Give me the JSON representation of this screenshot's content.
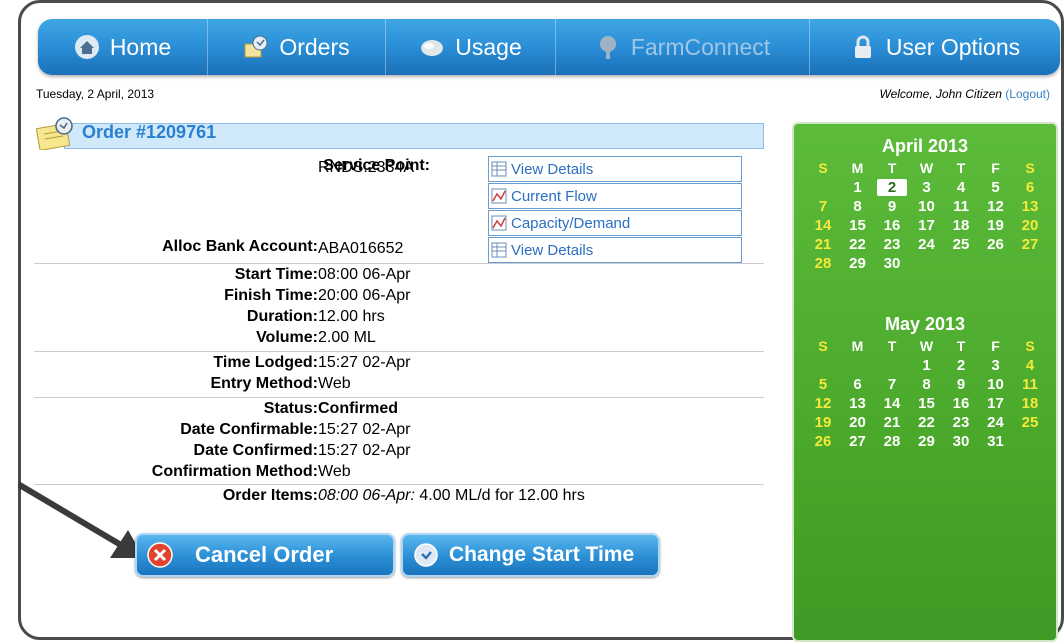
{
  "nav": {
    "items": [
      {
        "label": "Home",
        "icon": "home-icon"
      },
      {
        "label": "Orders",
        "icon": "orders-icon"
      },
      {
        "label": "Usage",
        "icon": "usage-icon"
      },
      {
        "label": "FarmConnect",
        "icon": "farmconnect-icon"
      },
      {
        "label": "User Options",
        "icon": "lock-icon"
      }
    ]
  },
  "header": {
    "date": "Tuesday, 2 April, 2013",
    "welcome": "Welcome, John Citizen",
    "logout": "(Logout)"
  },
  "order": {
    "title": "Order #1209761",
    "service_point_label": "Service Point:",
    "service_point": "RNDS.2334A",
    "links": [
      "View Details",
      "Current Flow",
      "Capacity/Demand",
      "View Details"
    ],
    "alloc_label": "Alloc Bank Account:",
    "alloc": "ABA016652",
    "start_label": "Start Time:",
    "start": "08:00 06-Apr",
    "finish_label": "Finish Time:",
    "finish": "20:00 06-Apr",
    "duration_label": "Duration:",
    "duration": "12.00 hrs",
    "volume_label": "Volume:",
    "volume": "2.00 ML",
    "lodged_label": "Time Lodged:",
    "lodged": "15:27 02-Apr",
    "entry_label": "Entry Method:",
    "entry": "Web",
    "status_label": "Status:",
    "status": "Confirmed",
    "confirmable_label": "Date Confirmable:",
    "confirmable": "15:27 02-Apr",
    "confirmed_label": "Date Confirmed:",
    "confirmed": "15:27 02-Apr",
    "conf_method_label": "Confirmation Method:",
    "conf_method": "Web",
    "items_label": "Order Items:",
    "items_time": "08:00 06-Apr:",
    "items_value": "4.00 ML/d for 12.00 hrs"
  },
  "buttons": {
    "cancel": "Cancel Order",
    "change": "Change Start Time"
  },
  "calendar": {
    "dow": [
      "S",
      "M",
      "T",
      "W",
      "T",
      "F",
      "S"
    ],
    "months": [
      {
        "title": "April 2013",
        "start": 1,
        "days": 30,
        "today": 2
      },
      {
        "title": "May 2013",
        "start": 3,
        "days": 31,
        "today": 0
      }
    ]
  },
  "colors": {
    "nav": "#2a8ed6",
    "calendar": "#4aa82b",
    "link": "#2b6fc0",
    "weekend": "#f4ea3c"
  }
}
